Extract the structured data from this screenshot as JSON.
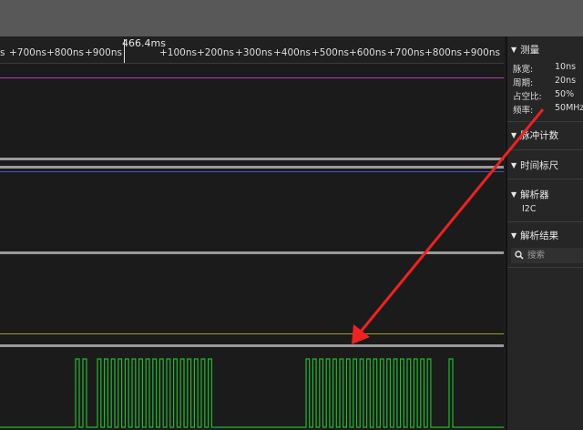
{
  "colors": {
    "channel1": "#b03ab8",
    "channel2": "#4a4ad8",
    "channel3": "#a8a028",
    "channel4": "#22b82e",
    "annotation_arrow": "#ee2222"
  },
  "ruler": {
    "cursor_label": "466.4ms",
    "ticks": [
      "s",
      "+700ns",
      "+800ns",
      "+900ns",
      "+100ns",
      "+200ns",
      "+300ns",
      "+400ns",
      "+500ns",
      "+600ns",
      "+700ns",
      "+800ns",
      "+900ns"
    ]
  },
  "sidebar": {
    "measure": {
      "title": "测量",
      "rows": [
        {
          "label": "脉宽:",
          "value": "10ns"
        },
        {
          "label": "周期:",
          "value": "20ns"
        },
        {
          "label": "占空比:",
          "value": "50%"
        },
        {
          "label": "频率:",
          "value": "50MHz"
        }
      ]
    },
    "pulse_count": {
      "title": "脉冲计数"
    },
    "time_ruler": {
      "title": "时间标尺"
    },
    "decoder": {
      "title": "解析器",
      "item": "I2C"
    },
    "results": {
      "title": "解析结果",
      "search_placeholder": "搜索"
    }
  }
}
